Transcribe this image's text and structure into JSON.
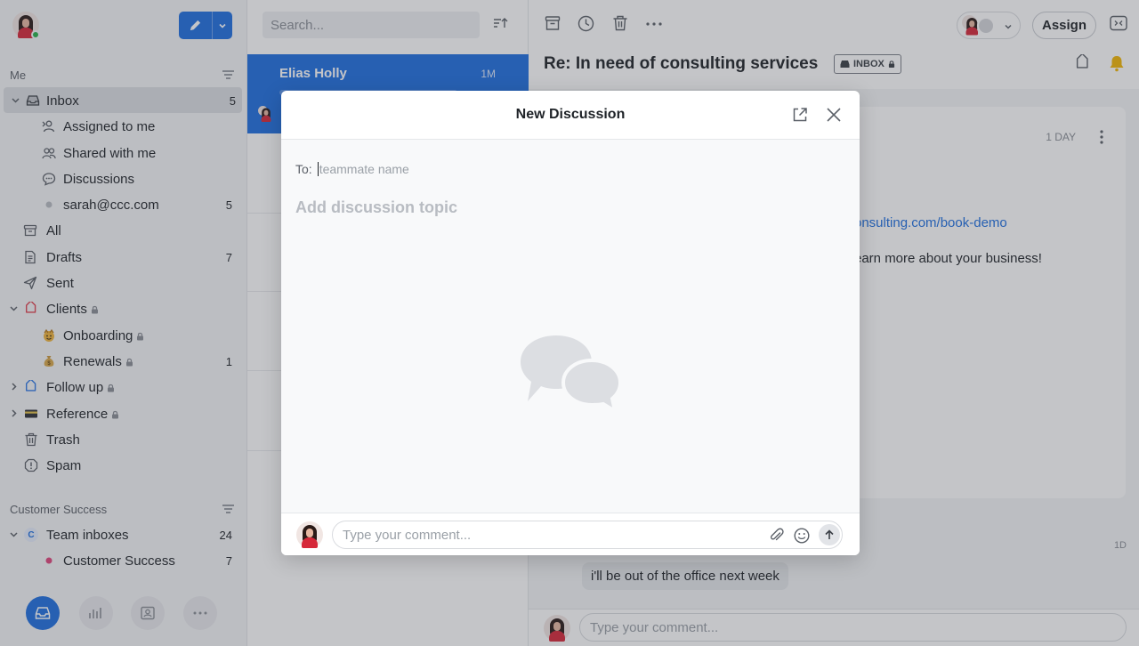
{
  "sidebar": {
    "me_section": "Me",
    "items": [
      {
        "label": "Inbox",
        "count": "5"
      },
      {
        "label": "Assigned to me",
        "count": ""
      },
      {
        "label": "Shared with me",
        "count": ""
      },
      {
        "label": "Discussions",
        "count": ""
      },
      {
        "label": "sarah@ccc.com",
        "count": "5"
      },
      {
        "label": "All",
        "count": ""
      },
      {
        "label": "Drafts",
        "count": "7"
      },
      {
        "label": "Sent",
        "count": ""
      },
      {
        "label": "Clients",
        "count": ""
      },
      {
        "label": "Onboarding",
        "count": ""
      },
      {
        "label": "Renewals",
        "count": "1"
      },
      {
        "label": "Follow up",
        "count": ""
      },
      {
        "label": "Reference",
        "count": ""
      },
      {
        "label": "Trash",
        "count": ""
      },
      {
        "label": "Spam",
        "count": ""
      }
    ],
    "team_section": "Customer Success",
    "team_items": [
      {
        "label": "Team inboxes",
        "count": "24",
        "badge": "C"
      },
      {
        "label": "Customer Success",
        "count": "7"
      }
    ]
  },
  "list": {
    "search_placeholder": "Search...",
    "selected": {
      "from": "Elias Holly",
      "time": "1M"
    }
  },
  "pane": {
    "assign_label": "Assign",
    "subject": "Re: In need of consulting services",
    "badge": "INBOX",
    "card_time": "1 DAY",
    "card_link": "onsulting.com/book-demo",
    "card_text": "earn more about your business!",
    "bubble_text": "i'll be out of the office next week",
    "bubble_time": "1D",
    "comment_placeholder": "Type your comment..."
  },
  "modal": {
    "title": "New Discussion",
    "to_label": "To:",
    "to_placeholder": "teammate name",
    "topic_placeholder": "Add discussion topic",
    "comment_placeholder": "Type your comment..."
  },
  "colors": {
    "accent": "#1f6fe0",
    "online": "#27b04a",
    "notification": "#f2b705"
  }
}
